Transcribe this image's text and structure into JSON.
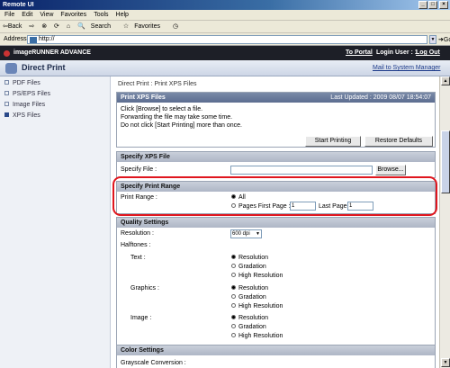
{
  "window": {
    "title": "Remote UI"
  },
  "menu": [
    "File",
    "Edit",
    "View",
    "Favorites",
    "Tools",
    "Help"
  ],
  "toolbar": {
    "back": "⇦Back",
    "forward": "⇨",
    "search": "Search",
    "favorites": "Favorites"
  },
  "address": {
    "label": "Address",
    "value": "http://",
    "go": "Go"
  },
  "header": {
    "brand": "imageRUNNER ADVANCE",
    "to_portal": "To Portal",
    "login_user": "Login User : 1",
    "logout": "Log Out"
  },
  "subheader": {
    "title": "Direct Print",
    "mail": "Mail to System Manager"
  },
  "sidebar": {
    "items": [
      {
        "label": "PDF Files",
        "active": false
      },
      {
        "label": "PS/EPS Files",
        "active": false
      },
      {
        "label": "Image Files",
        "active": false
      },
      {
        "label": "XPS Files",
        "active": true
      }
    ]
  },
  "breadcrumb": "Direct Print : Print XPS Files",
  "print_xps": {
    "title": "Print XPS Files",
    "last_updated": "Last Updated : 2009 08/07 18:54:07",
    "instructions": [
      "Click [Browse] to select a file.",
      "Forwarding the file may take some time.",
      "Do not click [Start Printing] more than once."
    ],
    "start": "Start Printing",
    "restore": "Restore Defaults"
  },
  "specify_file": {
    "title": "Specify XPS File",
    "label": "Specify File :",
    "browse": "Browse..."
  },
  "print_range": {
    "title": "Specify Print Range",
    "label": "Print Range :",
    "all": "All",
    "pages": "Pages First Page :",
    "first_value": "1",
    "last_label": "Last Page :",
    "last_value": "1"
  },
  "quality": {
    "title": "Quality Settings",
    "resolution_label": "Resolution :",
    "resolution_value": "600 dpi",
    "halftones": "Halftones :",
    "groups": [
      {
        "label": "Text :",
        "options": [
          "Resolution",
          "Gradation",
          "High Resolution"
        ],
        "selected": 0
      },
      {
        "label": "Graphics :",
        "options": [
          "Resolution",
          "Gradation",
          "High Resolution"
        ],
        "selected": 0
      },
      {
        "label": "Image :",
        "options": [
          "Resolution",
          "Gradation",
          "High Resolution"
        ],
        "selected": 0
      }
    ]
  },
  "color": {
    "title": "Color Settings",
    "grayscale": "Grayscale Conversion :"
  }
}
